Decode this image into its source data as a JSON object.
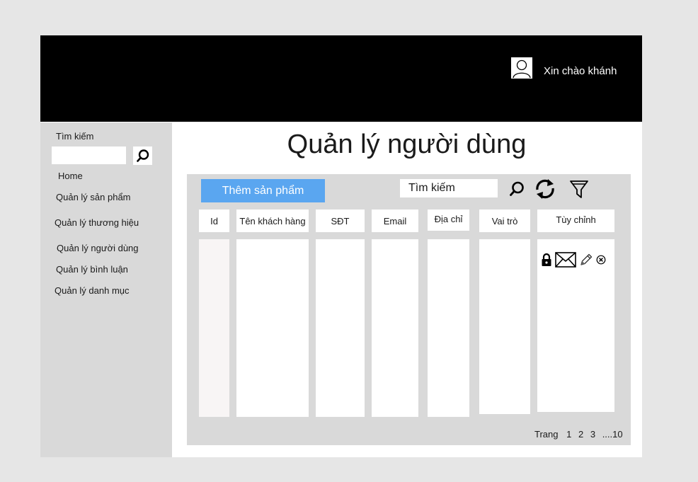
{
  "header": {
    "greeting": "Xin chào khánh"
  },
  "sidebar": {
    "search_label": "Tìm kiếm",
    "items": [
      {
        "label": "Home"
      },
      {
        "label": "Quản lý sản phẩm"
      },
      {
        "label": "Quản lý thương hiệu"
      },
      {
        "label": "Quản lý người dùng"
      },
      {
        "label": "Quản lý bình luận"
      },
      {
        "label": "Quản lý danh mục"
      }
    ]
  },
  "main": {
    "title": "Quản lý người dùng",
    "add_button": "Thêm sản phẩm",
    "search_text": "Tìm kiếm",
    "columns": [
      {
        "label": "Id"
      },
      {
        "label": "Tên khách hàng"
      },
      {
        "label": "SĐT"
      },
      {
        "label": "Email"
      },
      {
        "label": "Địa chỉ"
      },
      {
        "label": "Vai trò"
      },
      {
        "label": "Tùy chỉnh"
      }
    ],
    "row_actions": [
      "lock-icon",
      "mail-icon",
      "pencil-icon",
      "delete-icon"
    ],
    "pagination": {
      "label": "Trang",
      "pages": [
        "1",
        "2",
        "3",
        "....",
        "10"
      ]
    }
  },
  "colors": {
    "header_bg": "#000000",
    "sidebar_bg": "#d9d9d9",
    "panel_bg": "#d9d9d9",
    "accent": "#5aa6f0",
    "id_column_bg": "#f8f5f5"
  }
}
